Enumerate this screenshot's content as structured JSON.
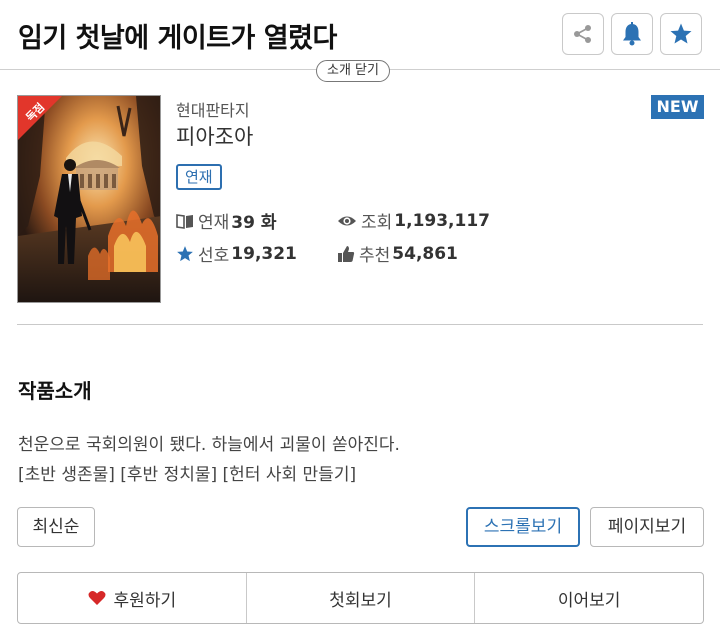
{
  "header": {
    "title": "임기 첫날에 게이트가 열렸다",
    "share_icon": "share-icon",
    "alarm_icon": "bell-icon",
    "favorite_icon": "star-icon",
    "toggle_intro_label": "소개 닫기"
  },
  "novel": {
    "exclusive_label": "독점",
    "genre": "현대판타지",
    "author": "피아조아",
    "status": "연재",
    "new_badge": "NEW",
    "stats": {
      "episodes_label": "연재",
      "episodes_value": "39 화",
      "views_label": "조회",
      "views_value": "1,193,117",
      "likes_label": "선호",
      "likes_value": "19,321",
      "recs_label": "추천",
      "recs_value": "54,861"
    }
  },
  "intro": {
    "title": "작품소개",
    "line1": "천운으로 국회의원이 됐다. 하늘에서 괴물이 쏟아진다.",
    "line2": "[초반 생존물] [후반 정치물] [헌터 사회 만들기]"
  },
  "controls": {
    "sort_label": "최신순",
    "scroll_view_label": "스크롤보기",
    "page_view_label": "페이지보기"
  },
  "bottom": {
    "sponsor_label": "후원하기",
    "first_episode_label": "첫회보기",
    "continue_label": "이어보기"
  },
  "colors": {
    "accent": "#2c72b4",
    "ribbon": "#e2362b",
    "heart": "#d62828"
  }
}
